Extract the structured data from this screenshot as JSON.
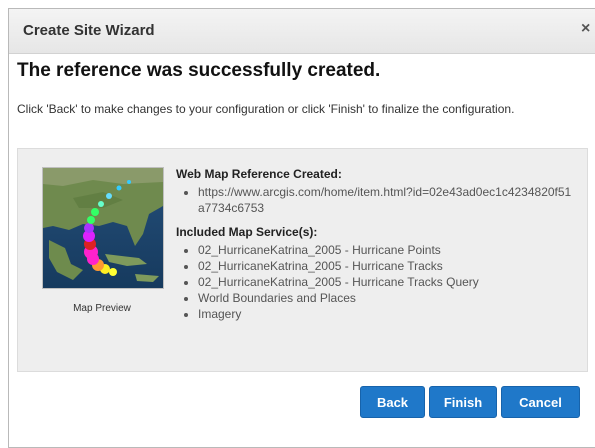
{
  "dialog": {
    "title": "Create Site Wizard",
    "close_label": "×"
  },
  "heading": "The reference was successfully created.",
  "instructions": "Click 'Back' to make changes to your configuration or click 'Finish' to finalize the configuration.",
  "preview": {
    "caption": "Map Preview"
  },
  "reference": {
    "title": "Web Map Reference Created:",
    "url": "https://www.arcgis.com/home/item.html?id=02e43ad0ec1c4234820f51a7734c6753"
  },
  "services": {
    "title": "Included Map Service(s):",
    "items": [
      "02_HurricaneKatrina_2005 - Hurricane Points",
      "02_HurricaneKatrina_2005 - Hurricane Tracks",
      "02_HurricaneKatrina_2005 - Hurricane Tracks Query",
      "World Boundaries and Places",
      "Imagery"
    ]
  },
  "buttons": {
    "back": "Back",
    "finish": "Finish",
    "cancel": "Cancel"
  },
  "colors": {
    "button": "#1f78c9",
    "panel": "#eeeeee",
    "titlebar": "#ececec"
  },
  "icons": {
    "close": "close-icon"
  }
}
